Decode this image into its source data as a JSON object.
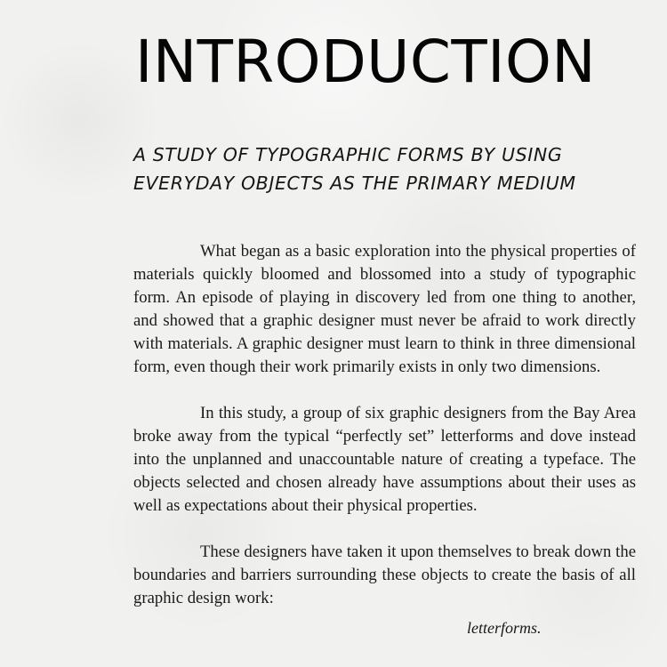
{
  "title": "INTRODUCTION",
  "subtitle": "A STUDY OF TYPOGRAPHIC FORMS BY USING EVERYDAY OBJECTS AS THE PRIMARY MEDIUM",
  "paragraphs": [
    "What began as a basic exploration into the physical properties of materials quickly bloomed and blossomed into a study of typographic form. An episode of playing in discovery led from one thing to another, and showed that a graphic designer must never be afraid to work directly with materials. A graphic designer must learn to think in three dimensional form, even though their work primarily exists in only two dimensions.",
    "In this study, a group of six graphic designers from the Bay Area broke away from the typical “perfectly set” letterforms and dove instead into the unplanned and unaccountable nature of creating a typeface. The objects selected and chosen already have assumptions about their uses as well as expectations about their physical properties.",
    "These designers have taken it upon themselves to break down the boundaries and barriers surrounding these objects to create the basis of all graphic design work:"
  ],
  "closing_word": "letterforms."
}
